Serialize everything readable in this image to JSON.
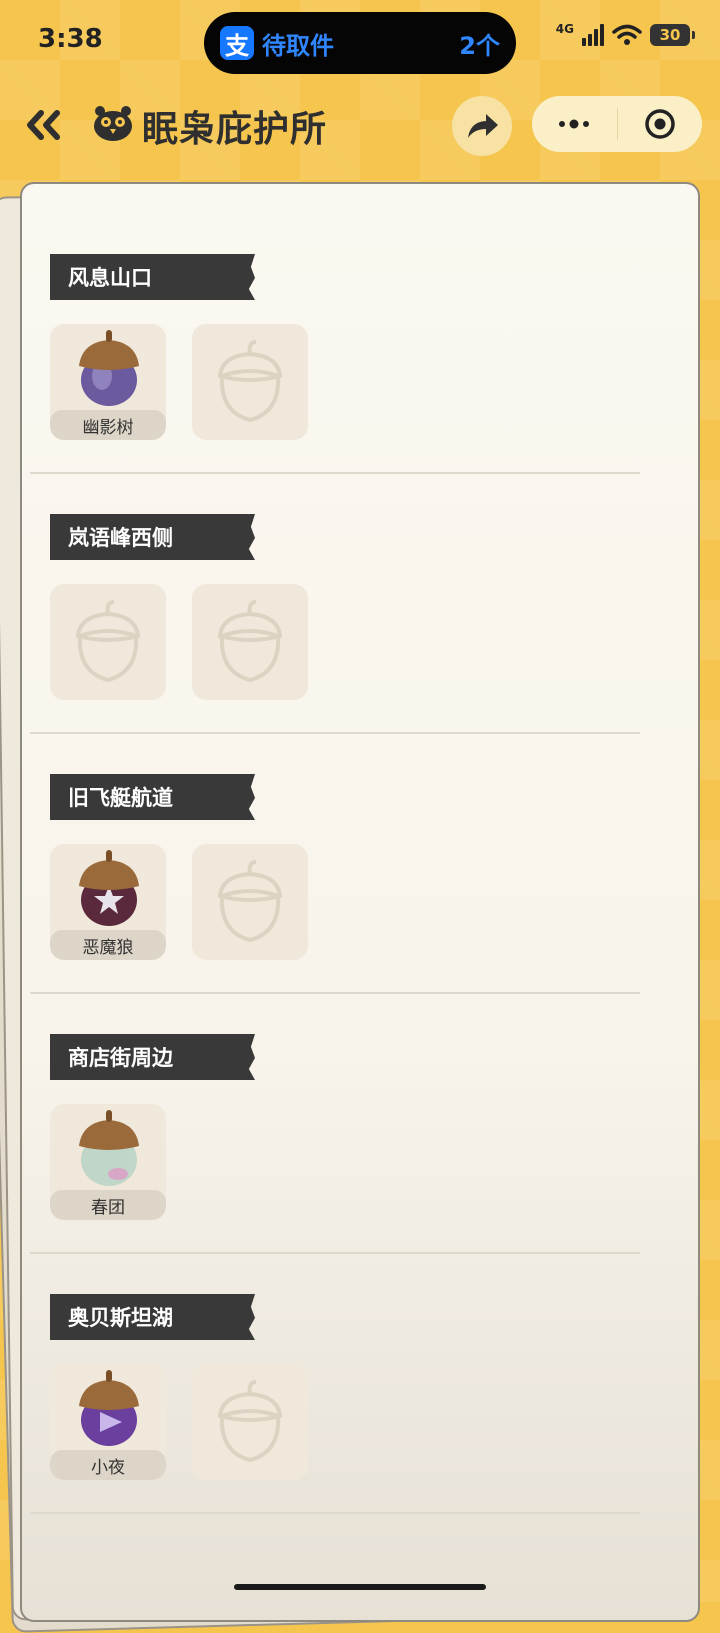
{
  "status_bar": {
    "time": "3:38",
    "notice_text": "待取件",
    "notice_count": "2个",
    "network": "4G",
    "battery": "30"
  },
  "header": {
    "title": "眠枭庇护所"
  },
  "sections": [
    {
      "label": "风息山口",
      "slots": [
        {
          "name": "幽影树",
          "color": "#6b5a9e"
        },
        {
          "name": ""
        }
      ]
    },
    {
      "label": "岚语峰西侧",
      "slots": [
        {
          "name": ""
        },
        {
          "name": ""
        }
      ]
    },
    {
      "label": "旧飞艇航道",
      "slots": [
        {
          "name": "恶魔狼",
          "color": "#5a2a3c"
        },
        {
          "name": ""
        }
      ]
    },
    {
      "label": "商店街周边",
      "slots": [
        {
          "name": "春团",
          "color": "#bfd6c8"
        }
      ]
    },
    {
      "label": "奥贝斯坦湖",
      "slots": [
        {
          "name": "小夜",
          "color": "#6a3f9e"
        },
        {
          "name": ""
        }
      ]
    }
  ],
  "colors": {
    "background": "#f5c54e",
    "label_bg": "#393939",
    "accent_blue": "#1677ff"
  }
}
